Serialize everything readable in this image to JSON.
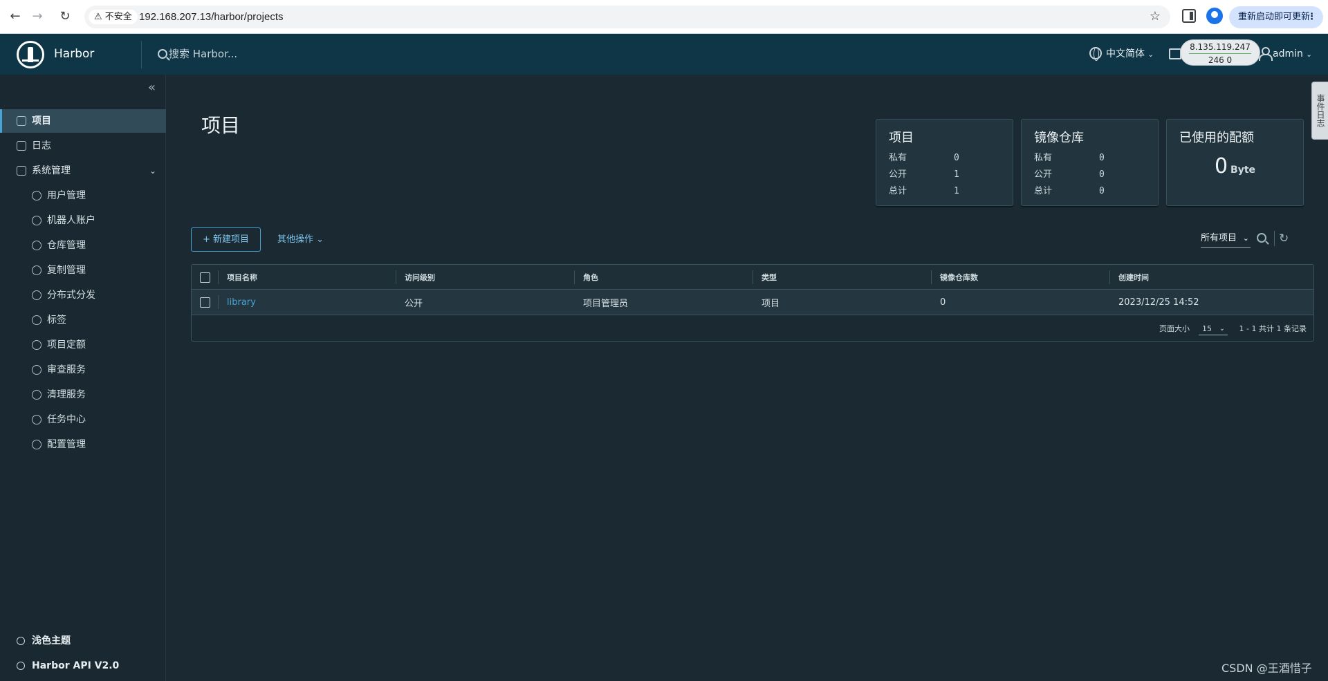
{
  "browser": {
    "insecure_label": "不安全",
    "url": "192.168.207.13/harbor/projects",
    "update_label": "重新启动即可更新",
    "menu_glyph": "⋮"
  },
  "header": {
    "brand": "Harbor",
    "search_placeholder": "搜索 Harbor...",
    "language": "中文简体",
    "user": "admin",
    "ip_overlay": {
      "ip": "8.135.119.247",
      "stats": "246  0"
    }
  },
  "sidebar": {
    "items": [
      {
        "label": "项目",
        "icon": "projects-icon",
        "active": true
      },
      {
        "label": "日志",
        "icon": "logs-icon"
      },
      {
        "label": "系统管理",
        "icon": "admin-icon",
        "expanded": true
      }
    ],
    "sub_items": [
      {
        "label": "用户管理",
        "icon": "users-icon"
      },
      {
        "label": "机器人账户",
        "icon": "robot-icon"
      },
      {
        "label": "仓库管理",
        "icon": "registry-icon"
      },
      {
        "label": "复制管理",
        "icon": "replication-icon"
      },
      {
        "label": "分布式分发",
        "icon": "share-icon"
      },
      {
        "label": "标签",
        "icon": "tag-icon"
      },
      {
        "label": "项目定额",
        "icon": "quota-icon"
      },
      {
        "label": "审查服务",
        "icon": "shield-icon"
      },
      {
        "label": "清理服务",
        "icon": "trash-icon"
      },
      {
        "label": "任务中心",
        "icon": "dashboard-icon"
      },
      {
        "label": "配置管理",
        "icon": "gear-icon"
      }
    ],
    "theme": "浅色主题",
    "api": "Harbor API V2.0"
  },
  "main": {
    "title": "项目",
    "cards": {
      "projects": {
        "title": "项目",
        "private_label": "私有",
        "private": "0",
        "public_label": "公开",
        "public": "1",
        "total_label": "总计",
        "total": "1"
      },
      "repos": {
        "title": "镜像仓库",
        "private_label": "私有",
        "private": "0",
        "public_label": "公开",
        "public": "0",
        "total_label": "总计",
        "total": "0"
      },
      "quota": {
        "title": "已使用的配额",
        "value": "0",
        "unit": "Byte"
      }
    },
    "new_project": "+ 新建项目",
    "other_ops": "其他操作",
    "filter": "所有项目",
    "columns": [
      "项目名称",
      "访问级别",
      "角色",
      "类型",
      "镜像仓库数",
      "创建时间"
    ],
    "rows": [
      [
        "library",
        "公开",
        "项目管理员",
        "项目",
        "0",
        "2023/12/25 14:52"
      ]
    ],
    "page_size_label": "页面大小",
    "page_size": "15",
    "page_info": "1 - 1 共计 1 条记录"
  },
  "side_tab": "事件日志",
  "watermark": "CSDN @王酒惜子"
}
